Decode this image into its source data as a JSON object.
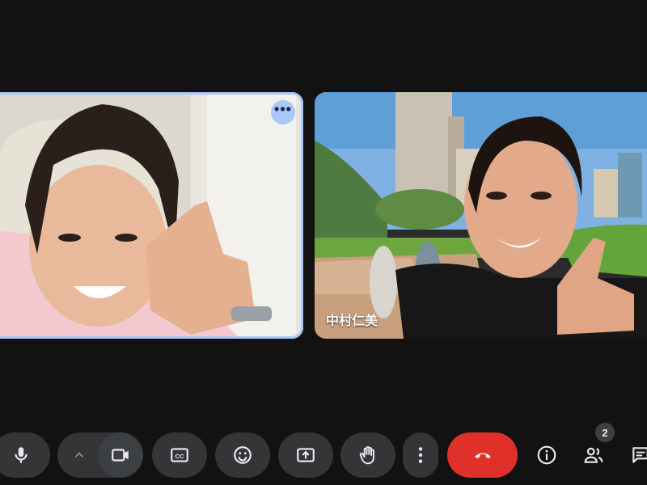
{
  "participants": [
    {
      "id": "self",
      "name": "",
      "has_more_options": true
    },
    {
      "id": "remote",
      "name": "中村仁美"
    }
  ],
  "self_tile": {
    "more_options_label": "•••"
  },
  "controls": {
    "mic": "mic-icon",
    "video_options": "chevron-up-icon",
    "camera": "camera-icon",
    "captions": "captions-icon",
    "reactions": "emoji-icon",
    "present": "present-screen-icon",
    "raise_hand": "hand-icon",
    "more": "more-vert-icon",
    "leave": "call-end-icon",
    "info": "info-icon",
    "people": "people-icon",
    "chat": "chat-icon"
  },
  "people_count": "2",
  "colors": {
    "background": "#121213",
    "active_speaker_ring": "#a8c7fa",
    "control_bg": "#333537",
    "hangup": "#e0302a"
  }
}
